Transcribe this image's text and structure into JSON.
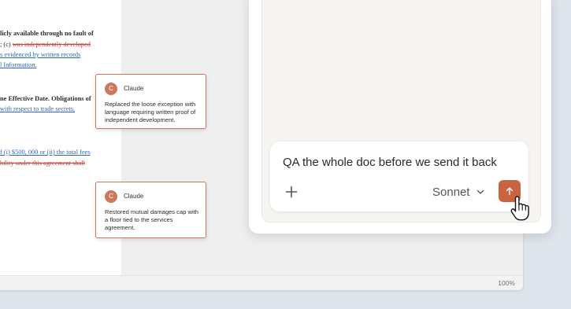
{
  "document": {
    "lines": [
      {
        "segments": [
          {
            "text": "licly available through no fault of",
            "style": "plain"
          }
        ]
      },
      {
        "segments": [
          {
            "text": "; (c) ",
            "style": "plain"
          },
          {
            "text": "was independently developed",
            "style": "del"
          }
        ]
      },
      {
        "segments": [
          {
            "text": "s evidenced by written records",
            "style": "ins"
          }
        ]
      },
      {
        "segments": [
          {
            "text": "l Information.",
            "style": "ins"
          }
        ]
      },
      {
        "segments": [
          {
            "text": "ne Effective Date. Obligations of",
            "style": "plain"
          }
        ]
      },
      {
        "segments": [
          {
            "text": "with respect to trade secrets,",
            "style": "ins"
          }
        ]
      },
      {
        "segments": [
          {
            "text": "f (i) $500, 000 or (ii) the total fees",
            "style": "ins"
          }
        ]
      },
      {
        "segments": [
          {
            "text": "bility under this agreement shall",
            "style": "del"
          }
        ]
      }
    ]
  },
  "comments": [
    {
      "avatar_letter": "C",
      "author": "Claude",
      "body": "Replaced the loose exception with language requiring written proof of independent development."
    },
    {
      "avatar_letter": "C",
      "author": "Claude",
      "body": "Restored mutual damages cap with a floor tied to the services agreement."
    }
  ],
  "status_bar": {
    "zoom": "100%"
  },
  "claude_panel": {
    "prompt": "QA the whole doc before we send it back",
    "model": "Sonnet",
    "icons": {
      "add": "plus-icon",
      "model_menu": "chevron-down-icon",
      "send": "arrow-up-icon",
      "pointer": "hand-cursor-icon"
    }
  },
  "colors": {
    "accent": "#c96442",
    "comment_border": "#cc785c",
    "insertion": "#2f67b2",
    "deletion": "#c2453a"
  }
}
